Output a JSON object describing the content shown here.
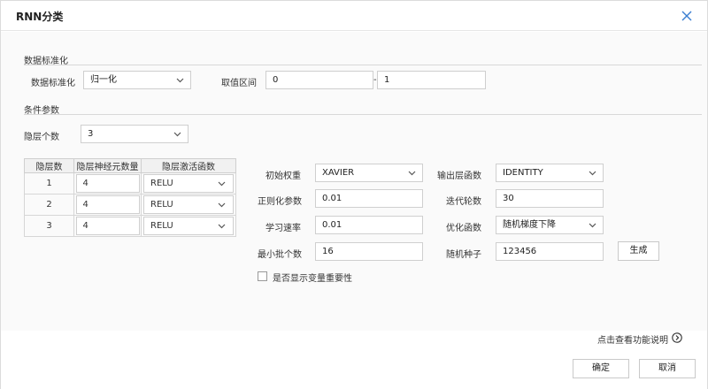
{
  "dialog": {
    "title": "RNN分类",
    "close_icon": "close-icon"
  },
  "normalization": {
    "section_title": "数据标准化",
    "method_label": "数据标准化",
    "method_value": "归一化",
    "range_label": "取值区间",
    "range_min": "0",
    "range_sep": "-",
    "range_max": "1"
  },
  "conditions": {
    "section_title": "条件参数",
    "hidden_layers_label": "隐层个数",
    "hidden_layers_value": "3"
  },
  "layer_table": {
    "headers": [
      "隐层数",
      "隐层神经元数量",
      "隐层激活函数"
    ],
    "rows": [
      {
        "layer": "1",
        "neurons": "4",
        "activation": "RELU"
      },
      {
        "layer": "2",
        "neurons": "4",
        "activation": "RELU"
      },
      {
        "layer": "3",
        "neurons": "4",
        "activation": "RELU"
      }
    ]
  },
  "params": {
    "init_weight_label": "初始权重",
    "init_weight_value": "XAVIER",
    "output_func_label": "输出层函数",
    "output_func_value": "IDENTITY",
    "regularization_label": "正则化参数",
    "regularization_value": "0.01",
    "iterations_label": "迭代轮数",
    "iterations_value": "30",
    "learning_rate_label": "学习速率",
    "learning_rate_value": "0.01",
    "optimizer_label": "优化函数",
    "optimizer_value": "随机梯度下降",
    "batch_label": "最小批个数",
    "batch_value": "16",
    "seed_label": "随机种子",
    "seed_value": "123456",
    "generate_label": "生成",
    "importance_label": "是否显示变量重要性"
  },
  "footer": {
    "help_label": "点击查看功能说明",
    "help_icon": "chevron-right-circle-icon",
    "ok_label": "确定",
    "cancel_label": "取消"
  }
}
